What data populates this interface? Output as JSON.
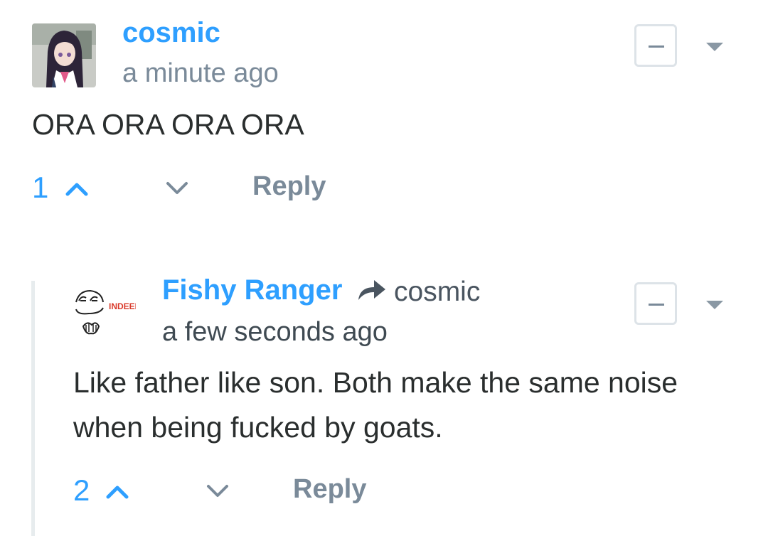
{
  "comments": [
    {
      "author": "cosmic",
      "timestamp": "a minute ago",
      "text": "ORA ORA ORA ORA",
      "votes": "1",
      "reply_label": "Reply",
      "collapse_icon": "minus-icon",
      "menu_icon": "caret-down-icon",
      "avatar": "anime-girl-avatar"
    },
    {
      "author": "Fishy Ranger",
      "in_reply_to": "cosmic",
      "timestamp": "a few seconds ago",
      "text_lines": [
        "Like father like son. Both make the same noise",
        "when being fucked by goats."
      ],
      "votes": "2",
      "reply_label": "Reply",
      "collapse_icon": "minus-icon",
      "menu_icon": "caret-down-icon",
      "avatar": "indeed-meme-face-avatar",
      "avatar_text": "INDEEI"
    }
  ],
  "colors": {
    "accent": "#2e9fff",
    "muted": "#7a8a99",
    "text": "#2a2e2e",
    "thread_line": "#e7ecee",
    "indeed_red": "#d93a2b"
  }
}
